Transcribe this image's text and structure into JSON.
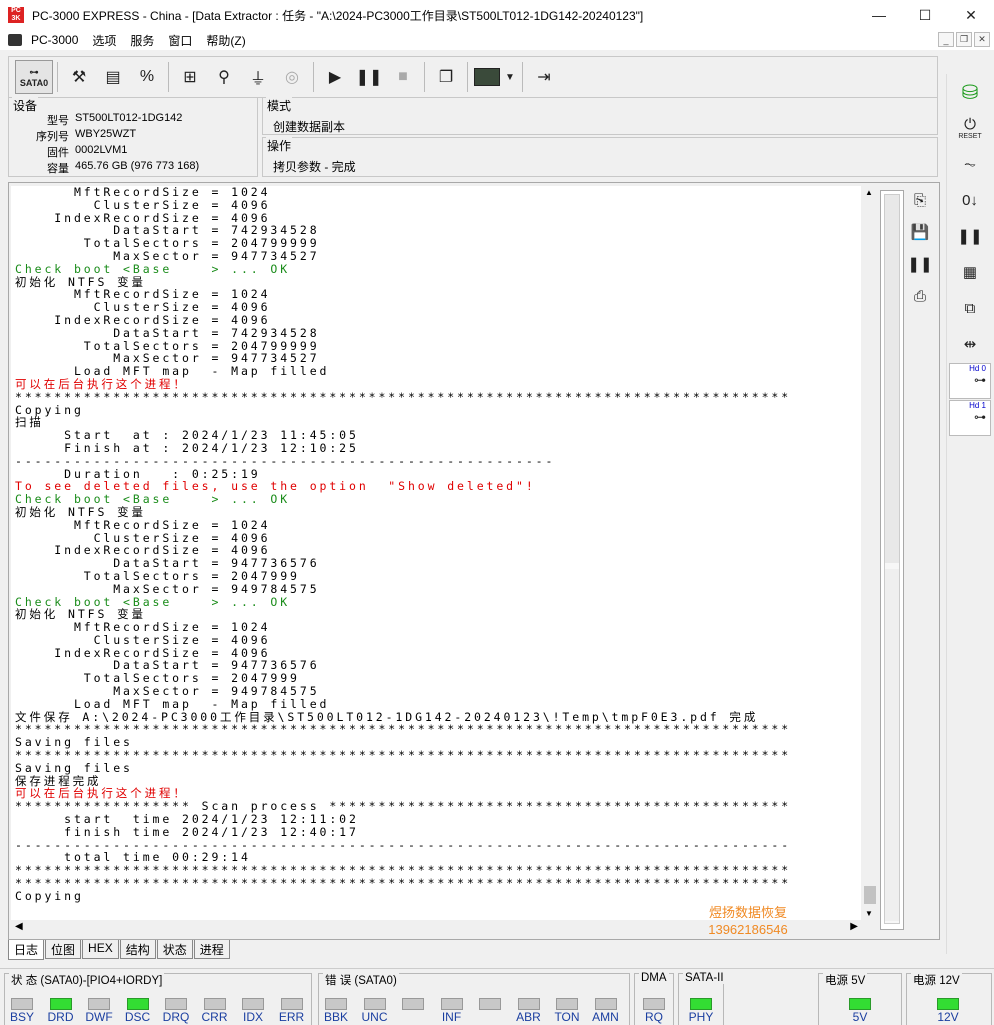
{
  "title": "PC-3000 EXPRESS - China - [Data Extractor : 任务 - \"A:\\2024-PC3000工作目录\\ST500LT012-1DG142-20240123\"]",
  "window_buttons": {
    "minimize": "—",
    "maximize": "☐",
    "close": "✕"
  },
  "menu": [
    "PC-3000",
    "选项",
    "服务",
    "窗口",
    "帮助(Z)"
  ],
  "toolbar": {
    "sata_label": "SATA0"
  },
  "device": {
    "legend": "设备",
    "rows": [
      {
        "k": "型号",
        "v": "ST500LT012-1DG142"
      },
      {
        "k": "序列号",
        "v": "WBY25WZT"
      },
      {
        "k": "固件",
        "v": "0002LVM1"
      },
      {
        "k": "容量",
        "v": "465.76 GB (976 773 168)"
      }
    ]
  },
  "mode": {
    "legend": "模式",
    "value": "创建数据副本"
  },
  "operation": {
    "legend": "操作",
    "value": "拷贝参数 - 完成"
  },
  "log": [
    {
      "c": "k",
      "t": "      MftRecordSize = 1024"
    },
    {
      "c": "k",
      "t": "        ClusterSize = 4096"
    },
    {
      "c": "k",
      "t": "    IndexRecordSize = 4096"
    },
    {
      "c": "k",
      "t": "          DataStart = 742934528"
    },
    {
      "c": "k",
      "t": "       TotalSectors = 204799999"
    },
    {
      "c": "k",
      "t": "          MaxSector = 947734527"
    },
    {
      "c": "g",
      "t": "Check boot <Base    > ... OK"
    },
    {
      "c": "k",
      "t": "初始化 NTFS 变量"
    },
    {
      "c": "k",
      "t": "      MftRecordSize = 1024"
    },
    {
      "c": "k",
      "t": "        ClusterSize = 4096"
    },
    {
      "c": "k",
      "t": "    IndexRecordSize = 4096"
    },
    {
      "c": "k",
      "t": "          DataStart = 742934528"
    },
    {
      "c": "k",
      "t": "       TotalSectors = 204799999"
    },
    {
      "c": "k",
      "t": "          MaxSector = 947734527"
    },
    {
      "c": "k",
      "t": "      Load MFT map  - Map filled"
    },
    {
      "c": "r",
      "t": "可以在后台执行这个进程！"
    },
    {
      "c": "k",
      "t": "*******************************************************************************"
    },
    {
      "c": "k",
      "t": "Copying"
    },
    {
      "c": "k",
      "t": "扫描"
    },
    {
      "c": "k",
      "t": "     Start  at : 2024/1/23 11:45:05"
    },
    {
      "c": "k",
      "t": "     Finish at : 2024/1/23 12:10:25"
    },
    {
      "c": "k",
      "t": "-------------------------------------------------------"
    },
    {
      "c": "k",
      "t": "     Duration   : 0:25:19"
    },
    {
      "c": "r",
      "t": "To see deleted files, use the option  \"Show deleted\"!"
    },
    {
      "c": "g",
      "t": "Check boot <Base    > ... OK"
    },
    {
      "c": "k",
      "t": "初始化 NTFS 变量"
    },
    {
      "c": "k",
      "t": "      MftRecordSize = 1024"
    },
    {
      "c": "k",
      "t": "        ClusterSize = 4096"
    },
    {
      "c": "k",
      "t": "    IndexRecordSize = 4096"
    },
    {
      "c": "k",
      "t": "          DataStart = 947736576"
    },
    {
      "c": "k",
      "t": "       TotalSectors = 2047999"
    },
    {
      "c": "k",
      "t": "          MaxSector = 949784575"
    },
    {
      "c": "g",
      "t": "Check boot <Base    > ... OK"
    },
    {
      "c": "k",
      "t": "初始化 NTFS 变量"
    },
    {
      "c": "k",
      "t": "      MftRecordSize = 1024"
    },
    {
      "c": "k",
      "t": "        ClusterSize = 4096"
    },
    {
      "c": "k",
      "t": "    IndexRecordSize = 4096"
    },
    {
      "c": "k",
      "t": "          DataStart = 947736576"
    },
    {
      "c": "k",
      "t": "       TotalSectors = 2047999"
    },
    {
      "c": "k",
      "t": "          MaxSector = 949784575"
    },
    {
      "c": "k",
      "t": "      Load MFT map  - Map filled"
    },
    {
      "c": "k",
      "t": "文件保存 A:\\2024-PC3000工作目录\\ST500LT012-1DG142-20240123\\!Temp\\tmpF0E3.pdf 完成"
    },
    {
      "c": "k",
      "t": "*******************************************************************************"
    },
    {
      "c": "k",
      "t": "Saving files"
    },
    {
      "c": "k",
      "t": "*******************************************************************************"
    },
    {
      "c": "k",
      "t": "Saving files"
    },
    {
      "c": "k",
      "t": "保存进程完成"
    },
    {
      "c": "r",
      "t": "可以在后台执行这个进程！"
    },
    {
      "c": "k",
      "t": "****************** Scan process ***********************************************"
    },
    {
      "c": "k",
      "t": "     start  time 2024/1/23 12:11:02"
    },
    {
      "c": "k",
      "t": "     finish time 2024/1/23 12:40:17"
    },
    {
      "c": "k",
      "t": "-------------------------------------------------------------------------------"
    },
    {
      "c": "k",
      "t": "     total time 00:29:14"
    },
    {
      "c": "k",
      "t": "*******************************************************************************"
    },
    {
      "c": "k",
      "t": "*******************************************************************************"
    },
    {
      "c": "k",
      "t": "Copying"
    }
  ],
  "watermark": {
    "line1": "煜扬数据恢复",
    "line2": "13962186546"
  },
  "tabs": [
    "日志",
    "位图",
    "HEX",
    "结构",
    "状态",
    "进程"
  ],
  "status": {
    "group1": {
      "title": "状 态 (SATA0)-[PIO4+IORDY]",
      "leds": [
        {
          "label": "BSY",
          "on": false
        },
        {
          "label": "DRD",
          "on": true
        },
        {
          "label": "DWF",
          "on": false
        },
        {
          "label": "DSC",
          "on": true
        },
        {
          "label": "DRQ",
          "on": false
        },
        {
          "label": "CRR",
          "on": false
        },
        {
          "label": "IDX",
          "on": false
        },
        {
          "label": "ERR",
          "on": false
        }
      ]
    },
    "group2": {
      "title": "错 误 (SATA0)",
      "leds": [
        {
          "label": "BBK",
          "on": false
        },
        {
          "label": "UNC",
          "on": false
        },
        {
          "label": "",
          "on": false
        },
        {
          "label": "INF",
          "on": false
        },
        {
          "label": "",
          "on": false
        },
        {
          "label": "ABR",
          "on": false
        },
        {
          "label": "TON",
          "on": false
        },
        {
          "label": "AMN",
          "on": false
        }
      ]
    },
    "dma": {
      "title": "DMA",
      "label": "RQ",
      "on": false
    },
    "sata": {
      "title": "SATA-II",
      "label": "PHY",
      "on": true
    },
    "p5": {
      "title": "电源 5V",
      "label": "5V",
      "on": true
    },
    "p12": {
      "title": "电源 12V",
      "label": "12V",
      "on": true
    }
  },
  "hd_buttons": [
    "Hd 0",
    "Hd 1"
  ]
}
